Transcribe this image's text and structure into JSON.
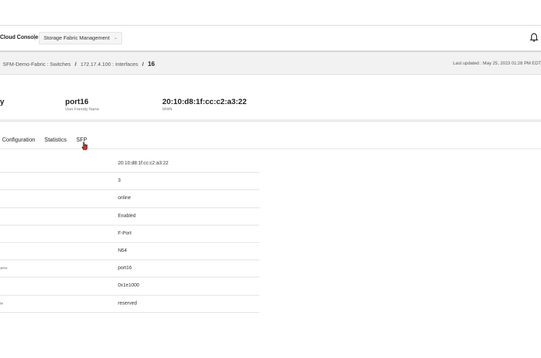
{
  "app": {
    "title": "Cloud Console",
    "separator": "|",
    "service": "Storage Fabric Management",
    "service_chevron": "⌄"
  },
  "breadcrumb": {
    "items": [
      "SFM-Demo-Fabric : Switches",
      "172.17.4.100 : Interfaces"
    ],
    "separator": "/",
    "current": "16",
    "last_updated": "Last updated :  May 25, 2023 01:28 PM EDT"
  },
  "summary": {
    "left_fragment": "y",
    "name_value": "port16",
    "name_label": "User Friendly Name",
    "wwn_value": "20:10:d8:1f:cc:c2:a3:22",
    "wwn_label": "WWN"
  },
  "tabs": [
    {
      "label": "Configuration"
    },
    {
      "label": "Statistics"
    },
    {
      "label": "SFP"
    }
  ],
  "rows": [
    {
      "label": "",
      "value": "20:10:d8:1f:cc:c2:a3:22"
    },
    {
      "label": "",
      "value": "3"
    },
    {
      "label": "",
      "value": "online"
    },
    {
      "label": "",
      "value": "Enabled"
    },
    {
      "label": "",
      "value": "F-Port"
    },
    {
      "label": "",
      "value": "N64"
    },
    {
      "label": "ame",
      "value": "port16"
    },
    {
      "label": "",
      "value": "0x1e1000"
    },
    {
      "label": "te",
      "value": "reserved"
    }
  ],
  "icons": {
    "bell": "bell-icon",
    "cursor": "hand-pointer-icon"
  },
  "colors": {
    "cursor_fill": "#c0392b"
  }
}
